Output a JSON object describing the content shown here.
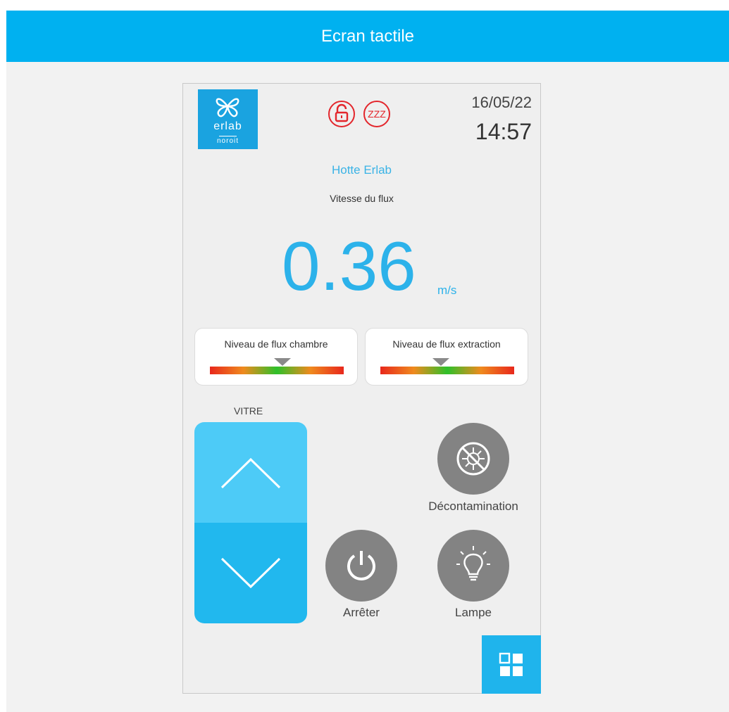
{
  "header": {
    "title": "Ecran tactile"
  },
  "device": {
    "logo": {
      "brand": "erlab",
      "subbrand": "noroit"
    },
    "status_icons": [
      "unlocked-padlock-icon",
      "sleep-zzz-icon"
    ],
    "status_color": "#e3262c",
    "date": "16/05/22",
    "time": "14:57",
    "name": "Hotte Erlab",
    "flow_label": "Vitesse du flux",
    "flow_value": "0.36",
    "flow_unit": "m/s",
    "gauges": [
      {
        "label": "Niveau de flux chambre",
        "level": 0.54
      },
      {
        "label": "Niveau de flux extraction",
        "level": 0.45
      }
    ],
    "vitre_label": "VITRE",
    "buttons": {
      "decontamination": "Décontamination",
      "stop": "Arrêter",
      "lamp": "Lampe"
    }
  },
  "colors": {
    "accent": "#00b1f0",
    "value_blue": "#2cb2ea",
    "button_gray": "#838383"
  }
}
